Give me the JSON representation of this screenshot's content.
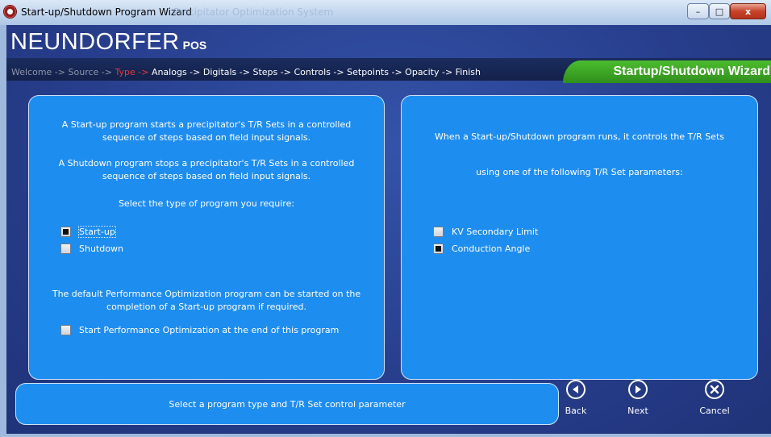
{
  "window": {
    "title": "Start-up/Shutdown Program Wizard",
    "background_title": "Precipitator Optimization System",
    "controls": {
      "minimize": "–",
      "maximize": "□",
      "close": "x"
    }
  },
  "brand": {
    "name": "NEUNDORFER",
    "suffix": "POS"
  },
  "breadcrumb": {
    "separator": " -> ",
    "steps": [
      {
        "label": "Welcome",
        "state": "done"
      },
      {
        "label": "Source",
        "state": "done"
      },
      {
        "label": "Type",
        "state": "current"
      },
      {
        "label": "Analogs",
        "state": "pending"
      },
      {
        "label": "Digitals",
        "state": "pending"
      },
      {
        "label": "Steps",
        "state": "pending"
      },
      {
        "label": "Controls",
        "state": "pending"
      },
      {
        "label": "Setpoints",
        "state": "pending"
      },
      {
        "label": "Opacity",
        "state": "pending"
      },
      {
        "label": "Finish",
        "state": "pending"
      }
    ]
  },
  "wizard_title": "Startup/Shutdown Wizard",
  "left_panel": {
    "startup_desc_line1": "A Start-up program starts a precipitator's T/R Sets in a controlled",
    "startup_desc_line2": "sequence of steps based on field input signals.",
    "shutdown_desc_line1": "A Shutdown program stops a precipitator's T/R Sets in a controlled",
    "shutdown_desc_line2": "sequence of steps based on field input signals.",
    "select_prompt": "Select the type of program you require:",
    "options": [
      {
        "label": "Start-up",
        "checked": true
      },
      {
        "label": "Shutdown",
        "checked": false
      }
    ],
    "perf_desc_line1": "The default Performance Optimization program can be started on the",
    "perf_desc_line2": "completion of a Start-up program if required.",
    "perf_option": {
      "label": "Start Performance Optimization at the end of this program",
      "checked": false
    }
  },
  "right_panel": {
    "desc_line1": "When a Start-up/Shutdown program runs, it controls the T/R Sets",
    "desc_line2": "using one of the following T/R Set parameters:",
    "options": [
      {
        "label": "KV Secondary Limit",
        "checked": false
      },
      {
        "label": "Conduction Angle",
        "checked": true
      }
    ]
  },
  "status_message": "Select a program type and T/R Set control parameter",
  "nav": {
    "back": "Back",
    "next": "Next",
    "cancel": "Cancel"
  },
  "colors": {
    "panel": "#1e8df0",
    "banner": "#13214a",
    "accent_green": "#3aa324",
    "current_step": "#e0393b"
  }
}
